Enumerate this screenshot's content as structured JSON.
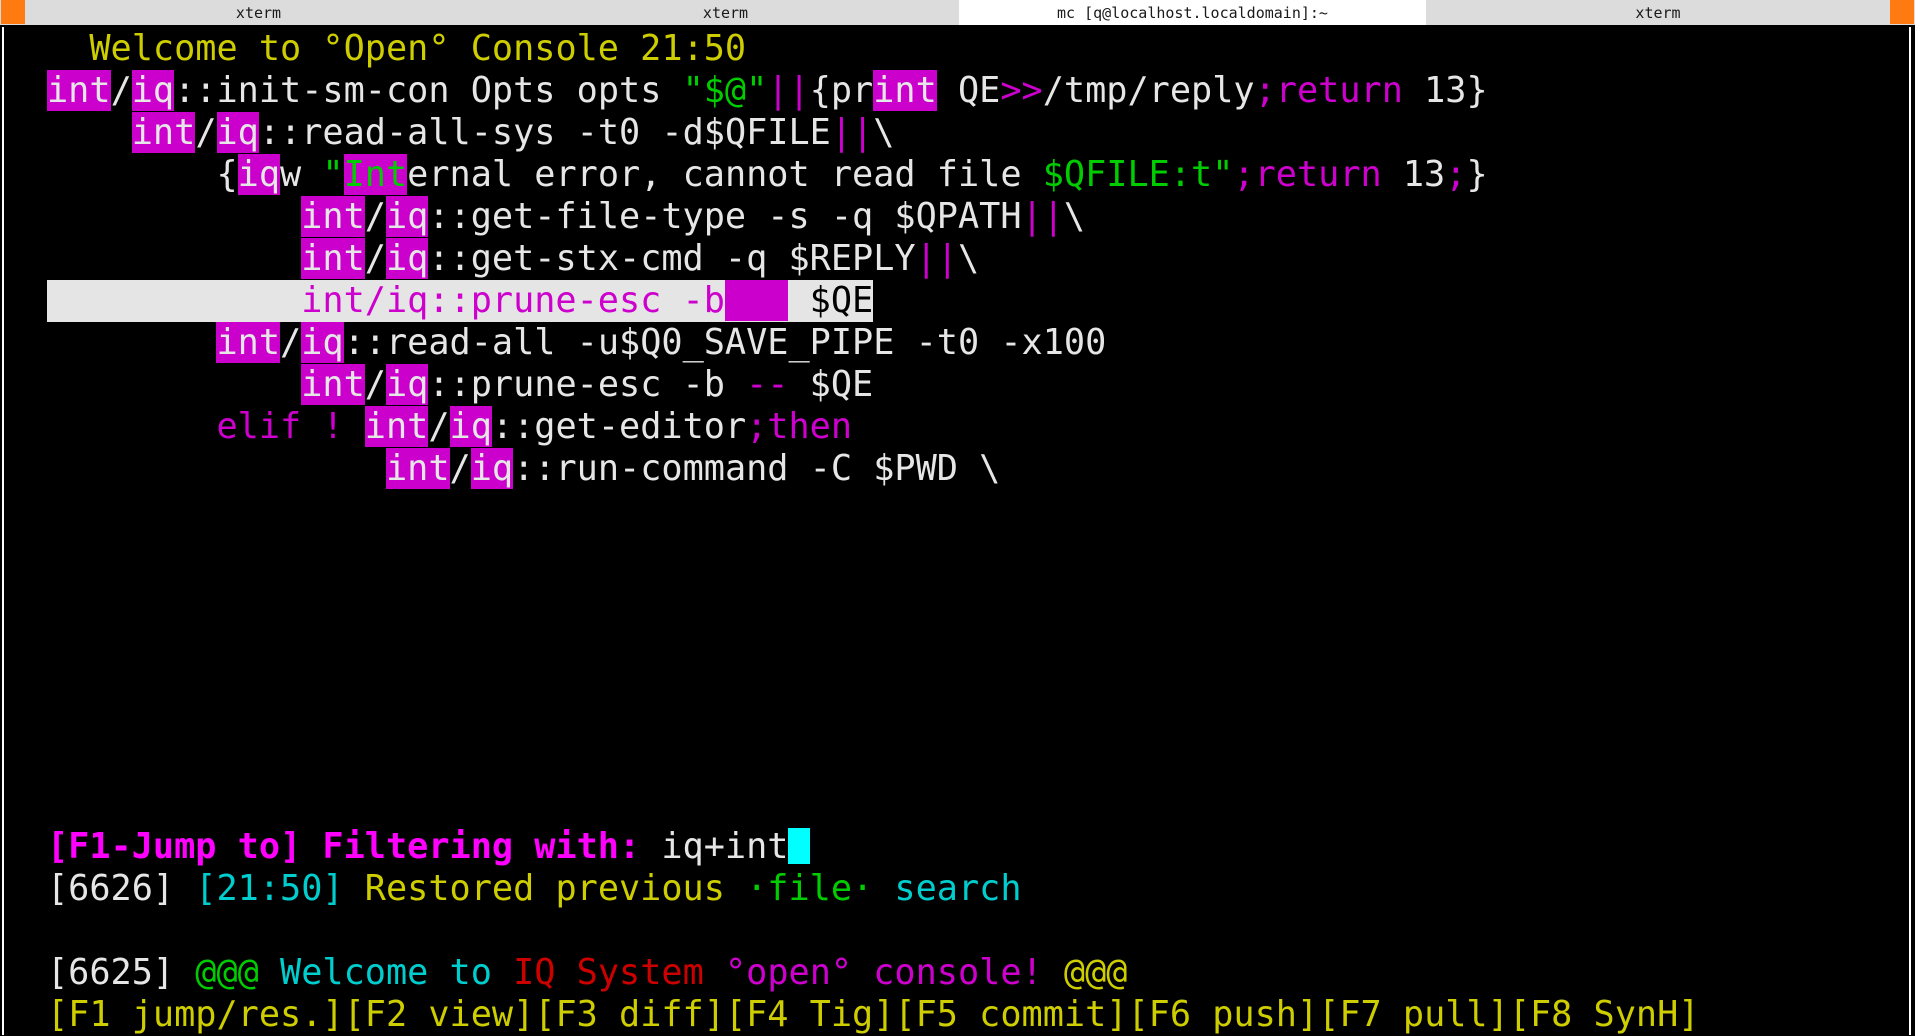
{
  "tabs": [
    {
      "label": "xterm",
      "active": false
    },
    {
      "label": "xterm",
      "active": false
    },
    {
      "label": "mc [q@localhost.localdomain]:~",
      "active": true
    },
    {
      "label": "xterm",
      "active": false
    }
  ],
  "colors": {
    "accent_corner": "#ff7a10",
    "match_highlight": "#cc00cc",
    "selected_line_bg": "#e5e5e5",
    "cursor": "#00ffff"
  },
  "terminal": {
    "welcome": "Welcome to °Open° Console 21:50",
    "lines": {
      "l1": {
        "a": "int",
        "b": "/",
        "c": "iq",
        "d": "::init-sm-con Opts opts ",
        "e": "\"$@\"",
        "f": "||",
        "g": "{pr",
        "h": "int",
        "i": " QE",
        "j": ">>",
        "k": "/tmp/reply",
        "l": ";return",
        "m": " 13}"
      },
      "l2": {
        "a": "int",
        "b": "/",
        "c": "iq",
        "d": "::read-all-sys -t0 -d$QFILE",
        "e": "||",
        "f": "\\"
      },
      "l3": {
        "a": "{",
        "b": "iq",
        "c": "w ",
        "d": "\"",
        "e": "Int",
        "f": "ernal error, cannot read file ",
        "g": "$QFILE:t\"",
        "h": ";return",
        "i": " 13",
        "j": ";",
        "k": "}"
      },
      "l4": {
        "a": "int",
        "b": "/",
        "c": "iq",
        "d": "::get-file-type -s -q $QPATH",
        "e": "||",
        "f": "\\"
      },
      "l5": {
        "a": "int",
        "b": "/",
        "c": "iq",
        "d": "::get-stx-cmd -q $REPLY",
        "e": "||",
        "f": "\\"
      },
      "l6": {
        "a": "int/iq::prune-esc -b",
        "b": "   ",
        "c": " ",
        "d": "$QE"
      },
      "l7": {
        "a": "int",
        "b": "/",
        "c": "iq",
        "d": "::read-all -u$Q0_SAVE_PIPE -t0 -x100"
      },
      "l8": {
        "a": "int",
        "b": "/",
        "c": "iq",
        "d": "::prune-esc -b ",
        "e": "--",
        "f": " $QE"
      },
      "l9": {
        "a": "elif ! ",
        "b": "int",
        "c": "/",
        "d": "iq",
        "e": "::get-editor",
        "f": ";then"
      },
      "l10": {
        "a": "int",
        "b": "/",
        "c": "iq",
        "d": "::run-command -C $PWD \\"
      }
    },
    "filter": {
      "label": "[F1-Jump to] Filtering with: ",
      "value": "iq+int"
    },
    "status1": {
      "id": "[6626]",
      "time": "[21:50]",
      "msg": "Restored previous",
      "file": "·file·",
      "search": "search"
    },
    "status2": {
      "id": "[6625]",
      "at1": "@@@",
      "welcome": "Welcome to",
      "iq": "IQ System",
      "open": "°open°",
      "console": "console!",
      "at2": "@@@"
    },
    "fkeys": [
      "[F1 jump/res.]",
      "[F2 view]",
      "[F3 diff]",
      "[F4 Tig]",
      "[F5 commit]",
      "[F6 push]",
      "[F7 pull]",
      "[F8 SynH]"
    ]
  }
}
